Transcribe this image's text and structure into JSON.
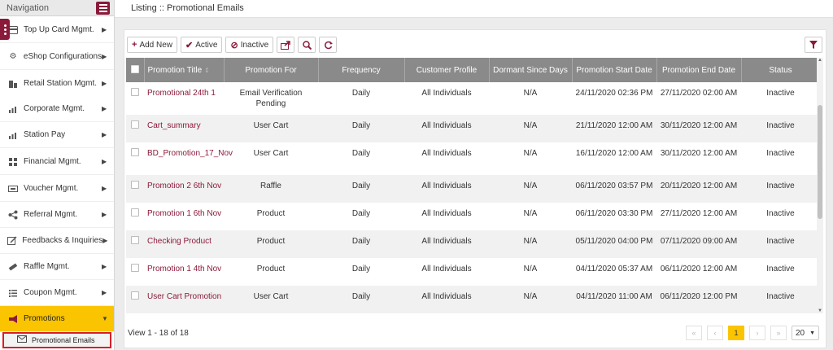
{
  "sidebar": {
    "title": "Navigation",
    "items": [
      {
        "label": "Top Up Card Mgmt.",
        "icon": "card-icon"
      },
      {
        "label": "eShop Configurations",
        "icon": "gear-icon"
      },
      {
        "label": "Retail Station Mgmt.",
        "icon": "building-icon"
      },
      {
        "label": "Corporate Mgmt.",
        "icon": "chart-icon"
      },
      {
        "label": "Station Pay",
        "icon": "chart-icon"
      },
      {
        "label": "Financial Mgmt.",
        "icon": "grid-icon"
      },
      {
        "label": "Voucher Mgmt.",
        "icon": "voucher-icon"
      },
      {
        "label": "Referral Mgmt.",
        "icon": "share-icon"
      },
      {
        "label": "Feedbacks & Inquiries",
        "icon": "edit-icon"
      },
      {
        "label": "Raffle Mgmt.",
        "icon": "ticket-icon"
      },
      {
        "label": "Coupon Mgmt.",
        "icon": "list-icon"
      },
      {
        "label": "Promotions",
        "icon": "megaphone-icon"
      }
    ],
    "submenu_label": "Promotional Emails"
  },
  "page": {
    "title": "Listing :: Promotional Emails"
  },
  "toolbar": {
    "add_label": "Add New",
    "active_label": "Active",
    "inactive_label": "Inactive"
  },
  "table": {
    "columns": [
      "Promotion Title",
      "Promotion For",
      "Frequency",
      "Customer Profile",
      "Dormant Since Days",
      "Promotion Start Date",
      "Promotion End Date",
      "Status"
    ],
    "rows": [
      [
        "Promotional 24th 1",
        "Email Verification Pending",
        "Daily",
        "All Individuals",
        "N/A",
        "24/11/2020 02:36 PM",
        "27/11/2020 02:00 AM",
        "Inactive"
      ],
      [
        "Cart_summary",
        "User Cart",
        "Daily",
        "All Individuals",
        "N/A",
        "21/11/2020 12:00 AM",
        "30/11/2020 12:00 AM",
        "Inactive"
      ],
      [
        "BD_Promotion_17_Nov",
        "User Cart",
        "Daily",
        "All Individuals",
        "N/A",
        "16/11/2020 12:00 AM",
        "30/11/2020 12:00 AM",
        "Inactive"
      ],
      [
        "Promotion 2 6th Nov",
        "Raffle",
        "Daily",
        "All Individuals",
        "N/A",
        "06/11/2020 03:57 PM",
        "20/11/2020 12:00 AM",
        "Inactive"
      ],
      [
        "Promotion 1 6th Nov",
        "Product",
        "Daily",
        "All Individuals",
        "N/A",
        "06/11/2020 03:30 PM",
        "27/11/2020 12:00 AM",
        "Inactive"
      ],
      [
        "Checking Product",
        "Product",
        "Daily",
        "All Individuals",
        "N/A",
        "05/11/2020 04:00 PM",
        "07/11/2020 09:00 AM",
        "Inactive"
      ],
      [
        "Promotion 1 4th Nov",
        "Product",
        "Daily",
        "All Individuals",
        "N/A",
        "04/11/2020 05:37 AM",
        "06/11/2020 12:00 AM",
        "Inactive"
      ],
      [
        "User Cart Promotion",
        "User Cart",
        "Daily",
        "All Individuals",
        "N/A",
        "04/11/2020 11:00 AM",
        "06/11/2020 12:00 PM",
        "Inactive"
      ]
    ]
  },
  "footer": {
    "view_text": "View 1 - 18 of 18",
    "current_page": "1",
    "page_size": "20"
  },
  "colors": {
    "brand": "#8b1a3a",
    "accent": "#fbc400",
    "header": "#8a8a8a"
  }
}
